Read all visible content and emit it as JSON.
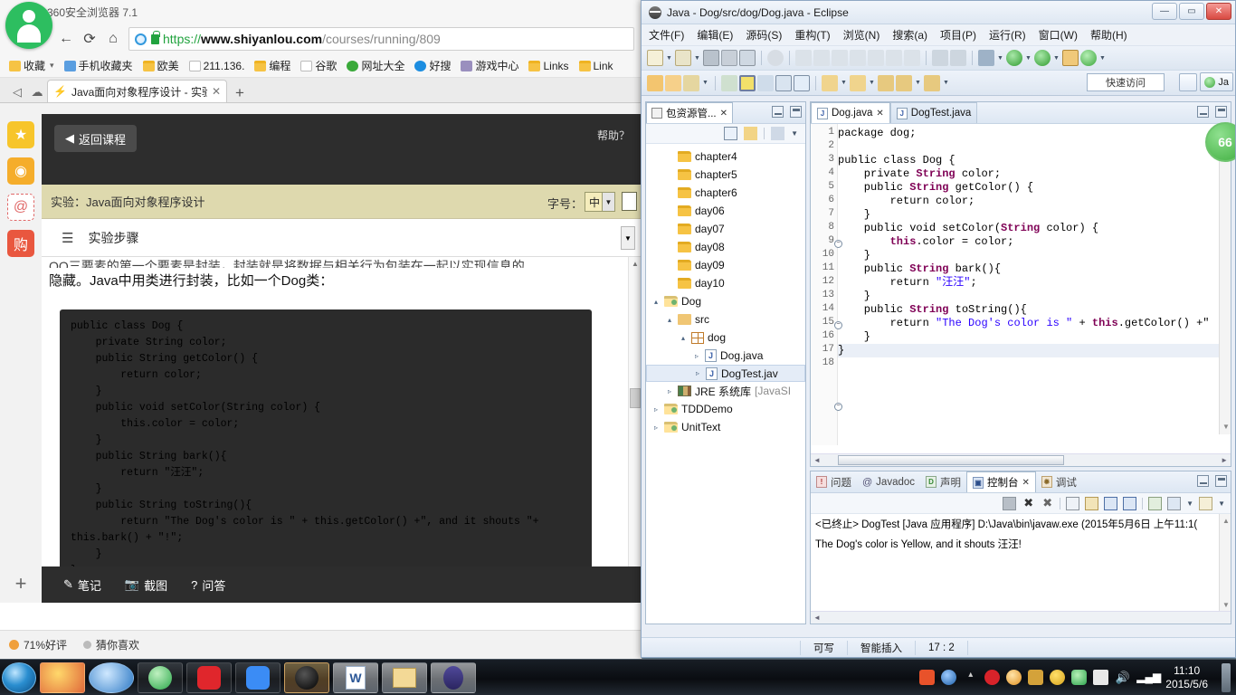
{
  "browser": {
    "app_title": "360安全浏览器 7.1",
    "nav": {
      "back": "←",
      "refresh": "⟳",
      "home": "⌂"
    },
    "url": {
      "scheme": "https://",
      "host": "www.shiyanlou.com",
      "path": "/courses/running/809"
    },
    "bookmarks": [
      {
        "label": "收藏",
        "icon": "star-icon",
        "caret": "▾"
      },
      {
        "label": "手机收藏夹",
        "icon": "phone-icon"
      },
      {
        "label": "欧美",
        "icon": "folder-icon"
      },
      {
        "label": "211.136.",
        "icon": "page-icon"
      },
      {
        "label": "编程",
        "icon": "folder-icon"
      },
      {
        "label": "谷歌",
        "icon": "page-icon"
      },
      {
        "label": "网址大全",
        "icon": "green-plus-icon"
      },
      {
        "label": "好搜",
        "icon": "search-blue-icon"
      },
      {
        "label": "游戏中心",
        "icon": "game-icon"
      },
      {
        "label": "Links",
        "icon": "folder-icon"
      },
      {
        "label": "Link",
        "icon": "folder-icon"
      }
    ],
    "tabs": [
      {
        "label": "Java面向对象程序设计 - 实验",
        "favicon": "lightning-icon",
        "close": "✕",
        "active": true
      }
    ],
    "new_tab": "+",
    "tab_nav_back": "◁",
    "tab_nav_cloud": "☁",
    "rail": [
      {
        "name": "favorites-rail-icon",
        "glyph": "★"
      },
      {
        "name": "weibo-rail-icon",
        "glyph": "◉"
      },
      {
        "name": "mail-rail-icon",
        "glyph": "@"
      },
      {
        "name": "shopping-rail-icon",
        "glyph": "购"
      }
    ],
    "rail_add": "+",
    "page": {
      "back_to_course": "返回课程",
      "back_arrow": "◀",
      "help": "帮助？",
      "experiment_title": "实验：Java面向对象程序设计",
      "font_size_label": "字号：",
      "font_size_value": "中",
      "steps_title": "实验步骤",
      "steps_icon": "list-icon",
      "clipped_line": "OO三要素的第一个要素是封装，封装就是将数据与相关行为包装在一起以实现信息的",
      "paragraph": "隐藏。Java中用类进行封装，比如一个Dog类：",
      "code": "public class Dog {\n    private String color;\n    public String getColor() {\n        return color;\n    }\n    public void setColor(String color) {\n        this.color = color;\n    }\n    public String bark(){\n        return \"汪汪\";\n    }\n    public String toString(){\n        return \"The Dog's color is \" + this.getColor() +\", and it shouts \"+\nthis.bark() + \"!\";\n    }\n}",
      "bottom_actions": [
        {
          "label": "笔记",
          "icon": "pencil-icon"
        },
        {
          "label": "截图",
          "icon": "camera-icon"
        },
        {
          "label": "问答",
          "icon": "question-icon"
        }
      ]
    },
    "status": [
      {
        "label": "71%好评",
        "icon": "rating-icon"
      },
      {
        "label": "猜你喜欢",
        "icon": "dot-icon"
      }
    ]
  },
  "eclipse": {
    "window_title": "Java - Dog/src/dog/Dog.java - Eclipse",
    "window_buttons": {
      "minimize": "—",
      "maximize": "▭",
      "close": "✕"
    },
    "menus": [
      "文件(F)",
      "编辑(E)",
      "源码(S)",
      "重构(T)",
      "浏览(N)",
      "搜索(a)",
      "项目(P)",
      "运行(R)",
      "窗口(W)",
      "帮助(H)"
    ],
    "quick_access": "快速访问",
    "perspective_label": "Ja",
    "package_explorer": {
      "tab_label": "包资源管...",
      "tab_close": "✕",
      "tree": [
        {
          "label": "chapter4",
          "icon": "folder-icon",
          "indent": 1,
          "arrow": ""
        },
        {
          "label": "chapter5",
          "icon": "folder-icon",
          "indent": 1,
          "arrow": ""
        },
        {
          "label": "chapter6",
          "icon": "folder-icon",
          "indent": 1,
          "arrow": ""
        },
        {
          "label": "day06",
          "icon": "folder-icon",
          "indent": 1,
          "arrow": ""
        },
        {
          "label": "day07",
          "icon": "folder-icon",
          "indent": 1,
          "arrow": ""
        },
        {
          "label": "day08",
          "icon": "folder-icon",
          "indent": 1,
          "arrow": ""
        },
        {
          "label": "day09",
          "icon": "folder-icon",
          "indent": 1,
          "arrow": ""
        },
        {
          "label": "day10",
          "icon": "folder-icon",
          "indent": 1,
          "arrow": ""
        },
        {
          "label": "Dog",
          "icon": "project-icon",
          "indent": 0,
          "arrow": "▴"
        },
        {
          "label": "src",
          "icon": "source-folder-icon",
          "indent": 1,
          "arrow": "▴"
        },
        {
          "label": "dog",
          "icon": "package-icon",
          "indent": 2,
          "arrow": "▴"
        },
        {
          "label": "Dog.java",
          "icon": "java-file-icon",
          "indent": 3,
          "arrow": "▹"
        },
        {
          "label": "DogTest.jav",
          "icon": "java-file-icon",
          "indent": 3,
          "arrow": "▹",
          "selected": true
        },
        {
          "label": "JRE 系统库",
          "suffix": "[JavaSI",
          "icon": "jre-library-icon",
          "indent": 1,
          "arrow": "▹"
        },
        {
          "label": "TDDDemo",
          "icon": "project-icon",
          "indent": 0,
          "arrow": "▹"
        },
        {
          "label": "UnitText",
          "icon": "project-icon",
          "indent": 0,
          "arrow": "▹"
        }
      ]
    },
    "editor": {
      "tabs": [
        {
          "label": "Dog.java",
          "active": true,
          "close": "✕"
        },
        {
          "label": "DogTest.java",
          "active": false
        }
      ],
      "code_lines": [
        {
          "n": "1",
          "fold": false,
          "text": "package dog;"
        },
        {
          "n": "2",
          "fold": false,
          "text": ""
        },
        {
          "n": "3",
          "fold": false,
          "text": "public class Dog {"
        },
        {
          "n": "4",
          "fold": false,
          "text": "    private String color;"
        },
        {
          "n": "5",
          "fold": true,
          "text": "    public String getColor() {"
        },
        {
          "n": "6",
          "fold": false,
          "text": "        return color;"
        },
        {
          "n": "7",
          "fold": false,
          "text": "    }"
        },
        {
          "n": "8",
          "fold": true,
          "text": "    public void setColor(String color) {"
        },
        {
          "n": "9",
          "fold": false,
          "text": "        this.color = color;"
        },
        {
          "n": "10",
          "fold": false,
          "text": "    }"
        },
        {
          "n": "11",
          "fold": true,
          "text": "    public String bark(){"
        },
        {
          "n": "12",
          "fold": false,
          "text": "        return \"汪汪\";"
        },
        {
          "n": "13",
          "fold": false,
          "text": "    }"
        },
        {
          "n": "14",
          "fold": true,
          "text": "    public String toString(){"
        },
        {
          "n": "15",
          "fold": false,
          "text": "        return \"The Dog's color is \" + this.getColor() +\""
        },
        {
          "n": "16",
          "fold": false,
          "text": "    }"
        },
        {
          "n": "17",
          "fold": false,
          "text": "}"
        },
        {
          "n": "18",
          "fold": false,
          "text": ""
        }
      ],
      "overview_badge": "66"
    },
    "console": {
      "tabs": [
        {
          "label": "问题",
          "icon": "problems-icon",
          "active": false
        },
        {
          "label": "Javadoc",
          "icon": "javadoc-icon",
          "active": false
        },
        {
          "label": "声明",
          "icon": "declaration-icon",
          "active": false
        },
        {
          "label": "控制台",
          "icon": "console-icon",
          "active": true,
          "close": "✕"
        },
        {
          "label": "调试",
          "icon": "debug-icon",
          "active": false
        }
      ],
      "launch_line": "<已终止> DogTest [Java 应用程序] D:\\Java\\bin\\javaw.exe (2015年5月6日 上午11:1(",
      "output": "The Dog's color is Yellow, and it shouts 汪汪!"
    },
    "status_bar": {
      "writable": "可写",
      "insert_mode": "智能插入",
      "position": "17 : 2"
    }
  },
  "taskbar": {
    "start": "start-orb",
    "items": [
      {
        "name": "taskbar-item-qq",
        "state": "normal"
      },
      {
        "name": "taskbar-item-ie",
        "state": "normal"
      },
      {
        "name": "taskbar-item-360-browser",
        "state": "normal"
      },
      {
        "name": "taskbar-item-netease-music",
        "state": "normal"
      },
      {
        "name": "taskbar-item-editor",
        "state": "normal"
      },
      {
        "name": "taskbar-item-disc",
        "state": "active"
      },
      {
        "name": "taskbar-item-word",
        "state": "normal"
      },
      {
        "name": "taskbar-item-explorer",
        "state": "normal"
      },
      {
        "name": "taskbar-item-eclipse",
        "state": "light"
      }
    ],
    "tray": [
      "sogou-icon",
      "help-icon",
      "show-hidden-icon",
      "netease-icon",
      "qq-browser-icon",
      "app-icon",
      "360-safe-icon",
      "360-shield-icon",
      "action-center-icon",
      "volume-icon",
      "network-icon"
    ],
    "clock_time": "11:10",
    "clock_date": "2015/5/6"
  }
}
